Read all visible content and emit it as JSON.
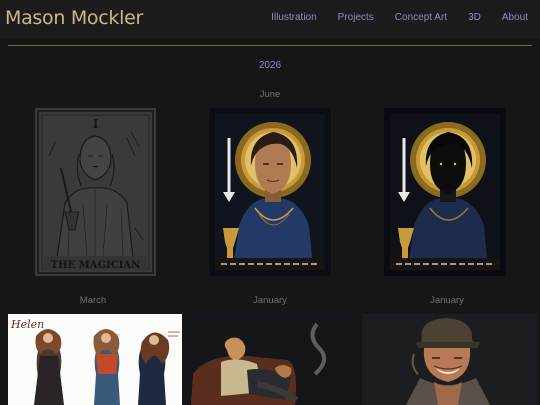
{
  "brand": {
    "name": "Mason Mockler"
  },
  "nav": {
    "items": [
      {
        "label": "Illustration"
      },
      {
        "label": "Projects"
      },
      {
        "label": "Concept Art"
      },
      {
        "label": "3D"
      },
      {
        "label": "About"
      }
    ]
  },
  "gallery": {
    "year": "2026",
    "captions": [
      "June",
      "March",
      "January",
      "January"
    ],
    "artworks": [
      {
        "name": "magician-tarot-sketch",
        "card_text": "THE MAGICIAN",
        "numeral": "I"
      },
      {
        "name": "magician-tarot-color"
      },
      {
        "name": "magician-tarot-shadow"
      },
      {
        "name": "character-turnaround",
        "signature": "Helen"
      },
      {
        "name": "seated-figures-painting"
      },
      {
        "name": "cap-portrait-painting"
      }
    ]
  },
  "colors": {
    "background": "#161616",
    "header": "#1c1c1c",
    "brand": "#c9b98a",
    "nav": "#8c8cc4",
    "caption": "#70707a"
  }
}
